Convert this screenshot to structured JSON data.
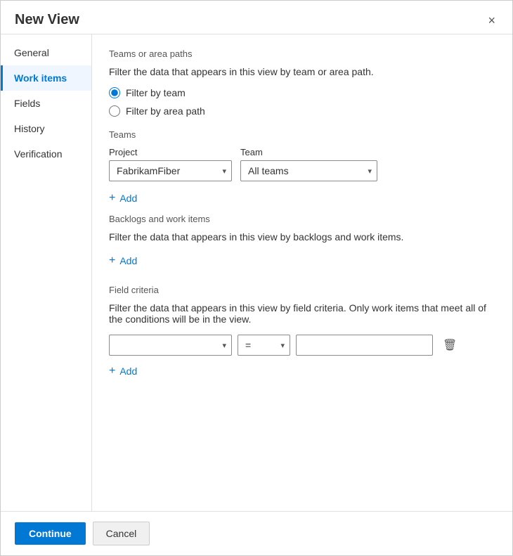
{
  "dialog": {
    "title": "New View",
    "close_icon": "×"
  },
  "sidebar": {
    "items": [
      {
        "id": "general",
        "label": "General",
        "active": false
      },
      {
        "id": "work-items",
        "label": "Work items",
        "active": true
      },
      {
        "id": "fields",
        "label": "Fields",
        "active": false
      },
      {
        "id": "history",
        "label": "History",
        "active": false
      },
      {
        "id": "verification",
        "label": "Verification",
        "active": false
      }
    ]
  },
  "main": {
    "section_teams_paths": {
      "title": "Teams or area paths",
      "desc": "Filter the data that appears in this view by team or area path.",
      "radio_filter_team": "Filter by team",
      "radio_filter_area": "Filter by area path",
      "selected_radio": "filter-by-team"
    },
    "section_teams": {
      "label": "Teams",
      "project_label": "Project",
      "project_value": "FabrikamFiber",
      "team_label": "Team",
      "team_value": "All teams",
      "add_label": "Add"
    },
    "section_backlogs": {
      "title": "Backlogs and work items",
      "desc": "Filter the data that appears in this view by backlogs and work items.",
      "add_label": "Add"
    },
    "section_field_criteria": {
      "title": "Field criteria",
      "desc": "Filter the data that appears in this view by field criteria. Only work items that meet all of the conditions will be in the view.",
      "operator_value": "=",
      "add_label": "Add",
      "delete_icon": "🗑"
    }
  },
  "footer": {
    "continue_label": "Continue",
    "cancel_label": "Cancel"
  }
}
